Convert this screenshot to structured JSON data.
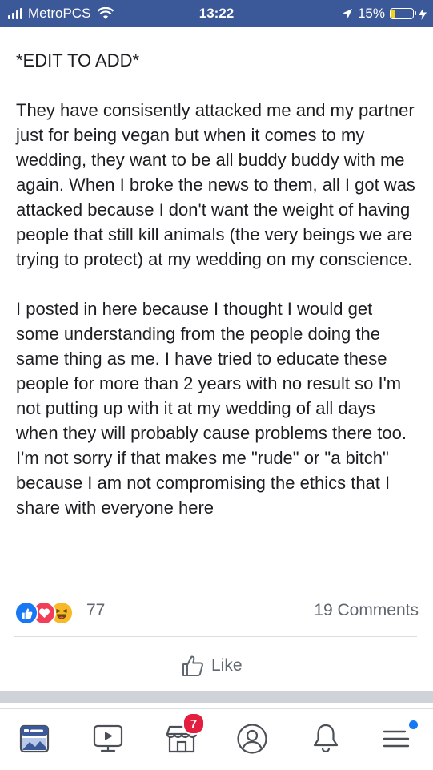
{
  "status_bar": {
    "carrier": "MetroPCS",
    "time": "13:22",
    "battery": "15%"
  },
  "post": {
    "edit_note": "*EDIT TO ADD*",
    "paragraphs": [
      "They have consisently attacked me and my partner just for being vegan but when it comes to my wedding, they want to be all buddy buddy with me again. When I broke the news to them, all I got was attacked because I don't want the weight of having people that still kill animals (the very beings we are trying to protect) at my wedding on my conscience.",
      "I posted in here because I thought I would get some understanding from the people doing the same thing as me. I have tried to educate these people for more than 2 years with no result so I'm not putting up with it at my wedding of all days when they will probably cause problems there too. I'm not sorry if that makes me \"rude\" or \"a bitch\" because I am not compromising the ethics that I share with everyone here"
    ]
  },
  "reactions": {
    "types": [
      "like",
      "love",
      "haha"
    ],
    "count": "77",
    "comments_label": "19 Comments"
  },
  "actions": {
    "like_label": "Like"
  },
  "tabbar": {
    "tabs": [
      "news-feed",
      "watch",
      "marketplace",
      "profile",
      "notifications",
      "menu"
    ],
    "marketplace_badge": "7"
  },
  "colors": {
    "brand_blue": "#3b5998",
    "like_blue": "#1877f2",
    "love_red": "#f33e58",
    "haha_yellow": "#f7b928",
    "badge_red": "#e41e3f"
  }
}
